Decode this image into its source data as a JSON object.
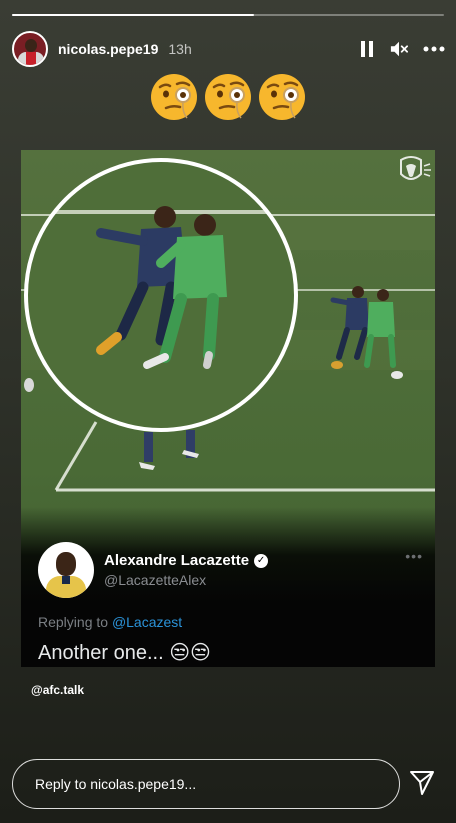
{
  "story": {
    "progress": 0.56,
    "username": "nicolas.pepe19",
    "time_ago": "13h",
    "emoji_count": 3,
    "emoji_name": "face-with-monocle"
  },
  "tweet": {
    "display_name": "Alexandre Lacazette",
    "handle": "@LacazetteAlex",
    "replying_prefix": "Replying to",
    "replying_to": "@Lacazest",
    "text": "Another one... 😒😒"
  },
  "credit": "@afc.talk",
  "reply": {
    "placeholder": "Reply to nicolas.pepe19..."
  },
  "colors": {
    "pitch": "#4a6b35",
    "mention": "#2b93d9",
    "kit_green": "#4fae5e",
    "kit_navy": "#2c3b63"
  }
}
